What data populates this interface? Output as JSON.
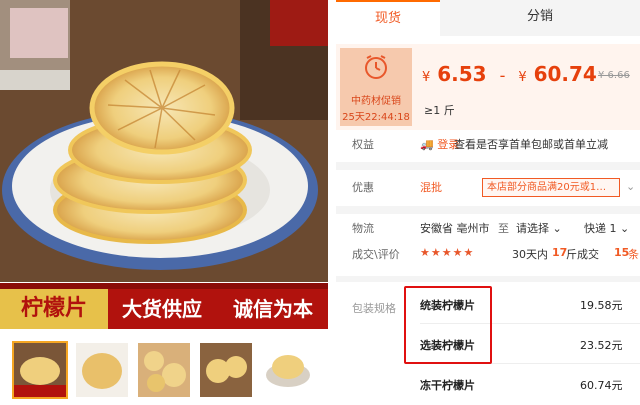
{
  "product": {
    "banner": {
      "left": "柠檬片",
      "middle": "大货供应",
      "right": "诚信为本"
    }
  },
  "tabs": [
    {
      "label": "现货"
    },
    {
      "label": "分销"
    }
  ],
  "promo": {
    "label": "中药材促销",
    "countdown": "25天22:44:18"
  },
  "price": {
    "currency": "¥",
    "low": "6.53",
    "separator": "-",
    "high": "60.74",
    "original": "¥ 6.66",
    "min_order": "≥1 斤"
  },
  "rights": {
    "label": "权益",
    "login": "登录",
    "text": "查看是否享首单包邮或首单立减"
  },
  "discount": {
    "label": "优惠",
    "tag": "混批",
    "coupon": "本店部分商品满20元或1…",
    "caret": "⌄"
  },
  "logistics": {
    "label": "物流",
    "from": "安徽省 亳州市",
    "to_word": "至",
    "select": "请选择 ⌄",
    "shipping": "快递 1 ⌄"
  },
  "reviews": {
    "label": "成交\\评价",
    "stars": "★★★★★",
    "sales_prefix": "30天内",
    "sales_count": "17",
    "sales_suffix": "斤成交",
    "review_count": "15",
    "review_suffix": "条"
  },
  "specs": {
    "label": "包装规格",
    "items": [
      {
        "name": "统装柠檬片",
        "price": "19.58元"
      },
      {
        "name": "选装柠檬片",
        "price": "23.52元"
      },
      {
        "name": "冻干柠檬片",
        "price": "60.74元"
      }
    ]
  },
  "colors": {
    "accent": "#f15a24",
    "price": "#e6400c",
    "banner": "#b1120d",
    "highlight_box": "#e01010"
  }
}
